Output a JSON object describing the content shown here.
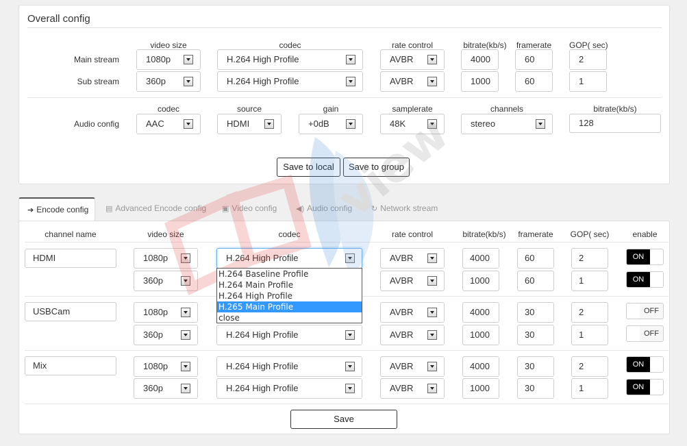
{
  "overall": {
    "title": "Overall config",
    "video_headers": {
      "video_size": "video size",
      "codec": "codec",
      "rate_control": "rate control",
      "bitrate": "bitrate(kb/s)",
      "framerate": "framerate",
      "gop": "GOP( sec)"
    },
    "main": {
      "label": "Main stream",
      "video_size": "1080p",
      "codec": "H.264 High Profile",
      "rate_control": "AVBR",
      "bitrate": "4000",
      "framerate": "60",
      "gop": "2"
    },
    "sub": {
      "label": "Sub stream",
      "video_size": "360p",
      "codec": "H.264 High Profile",
      "rate_control": "AVBR",
      "bitrate": "1000",
      "framerate": "60",
      "gop": "1"
    },
    "audio_headers": {
      "codec": "codec",
      "source": "source",
      "gain": "gain",
      "samplerate": "samplerate",
      "channels": "channels",
      "bitrate": "bitrate(kb/s)"
    },
    "audio": {
      "label": "Audio config",
      "codec": "AAC",
      "source": "HDMI",
      "gain": "+0dB",
      "samplerate": "48K",
      "channels": "stereo",
      "bitrate": "128"
    },
    "save_local": "Save to local",
    "save_group": "Save to group"
  },
  "tabs": [
    {
      "label": "Encode config",
      "icon": "sign-in-icon"
    },
    {
      "label": "Advanced Encode config",
      "icon": "file-icon"
    },
    {
      "label": "Video config",
      "icon": "image-icon"
    },
    {
      "label": "Audio config",
      "icon": "volume-icon"
    },
    {
      "label": "Network stream",
      "icon": "refresh-icon"
    }
  ],
  "encode": {
    "headers": {
      "channel_name": "channel name",
      "video_size": "video size",
      "codec": "codec",
      "rate_control": "rate control",
      "bitrate": "bitrate(kb/s)",
      "framerate": "framerate",
      "gop": "GOP( sec)",
      "enable": "enable"
    },
    "channels": [
      {
        "name": "HDMI",
        "main": {
          "video_size": "1080p",
          "codec": "H.264 High Profile",
          "rate_control": "AVBR",
          "bitrate": "4000",
          "framerate": "60",
          "gop": "2",
          "enable": "ON"
        },
        "sub": {
          "video_size": "360p",
          "codec": "",
          "rate_control": "AVBR",
          "bitrate": "1000",
          "framerate": "60",
          "gop": "1",
          "enable": "ON"
        }
      },
      {
        "name": "USBCam",
        "main": {
          "video_size": "1080p",
          "codec": "",
          "rate_control": "AVBR",
          "bitrate": "4000",
          "framerate": "30",
          "gop": "2",
          "enable": "OFF"
        },
        "sub": {
          "video_size": "360p",
          "codec": "H.264 High Profile",
          "rate_control": "AVBR",
          "bitrate": "1000",
          "framerate": "30",
          "gop": "1",
          "enable": "OFF"
        }
      },
      {
        "name": "Mix",
        "main": {
          "video_size": "1080p",
          "codec": "H.264 High Profile",
          "rate_control": "AVBR",
          "bitrate": "4000",
          "framerate": "30",
          "gop": "2",
          "enable": "ON"
        },
        "sub": {
          "video_size": "360p",
          "codec": "H.264 High Profile",
          "rate_control": "AVBR",
          "bitrate": "1000",
          "framerate": "30",
          "gop": "1",
          "enable": "ON"
        }
      }
    ],
    "dropdown_options": [
      "H.264 Baseline Profile",
      "H.264 Main Profile",
      "H.264 High Profile",
      "H.265 Main Profile",
      "close"
    ],
    "dropdown_highlight": "H.265 Main Profile",
    "save": "Save"
  },
  "watermark": {
    "text": "DB view",
    "colors": [
      "#e84a4a",
      "#4a90d9"
    ]
  }
}
